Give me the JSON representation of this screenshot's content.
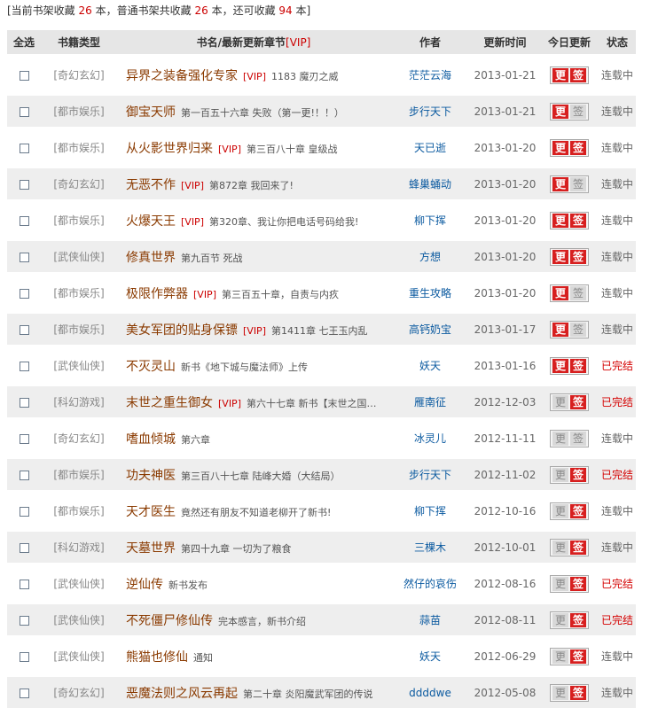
{
  "summary": {
    "prefix": "[当前书架收藏",
    "current": "26",
    "mid1": "本，普通书架共收藏",
    "total": "26",
    "mid2": "本，还可收藏",
    "remaining": "94",
    "suffix": "本]"
  },
  "header": {
    "select_all": "全选",
    "type": "书籍类型",
    "title": "书名/最新更新章节",
    "title_vip": "[VIP]",
    "author": "作者",
    "time": "更新时间",
    "today": "今日更新",
    "status": "状态"
  },
  "buttons": {
    "update": "更",
    "sign": "签"
  },
  "rows": [
    {
      "type": "[奇幻玄幻]",
      "title": "异界之装备强化专家",
      "vip": "[VIP]",
      "chapter": "1183 魔刃之威",
      "author": "茫茫云海",
      "time": "2013-01-21",
      "update_on": true,
      "sign_on": true,
      "status": "连载中",
      "done": false
    },
    {
      "type": "[都市娱乐]",
      "title": "御宝天师",
      "vip": "",
      "chapter": "第一百五十六章 失败（第一更!！！）",
      "author": "步行天下",
      "time": "2013-01-21",
      "update_on": true,
      "sign_on": false,
      "status": "连载中",
      "done": false
    },
    {
      "type": "[都市娱乐]",
      "title": "从火影世界归来",
      "vip": "[VIP]",
      "chapter": "第三百八十章 皇级战",
      "author": "天已逝",
      "time": "2013-01-20",
      "update_on": true,
      "sign_on": true,
      "status": "连载中",
      "done": false
    },
    {
      "type": "[奇幻玄幻]",
      "title": "无恶不作",
      "vip": "[VIP]",
      "chapter": "第872章 我回来了!",
      "author": "蜂巢蛹动",
      "time": "2013-01-20",
      "update_on": true,
      "sign_on": false,
      "status": "连载中",
      "done": false
    },
    {
      "type": "[都市娱乐]",
      "title": "火爆天王",
      "vip": "[VIP]",
      "chapter": "第320章、我让你把电话号码给我!",
      "author": "柳下挥",
      "time": "2013-01-20",
      "update_on": true,
      "sign_on": true,
      "status": "连载中",
      "done": false
    },
    {
      "type": "[武侠仙侠]",
      "title": "修真世界",
      "vip": "",
      "chapter": "第九百节 死战",
      "author": "方想",
      "time": "2013-01-20",
      "update_on": true,
      "sign_on": true,
      "status": "连载中",
      "done": false
    },
    {
      "type": "[都市娱乐]",
      "title": "极限作弊器",
      "vip": "[VIP]",
      "chapter": "第三百五十章，自责与内疚",
      "author": "重生攻略",
      "time": "2013-01-20",
      "update_on": true,
      "sign_on": false,
      "status": "连载中",
      "done": false
    },
    {
      "type": "[都市娱乐]",
      "title": "美女军团的贴身保镖",
      "vip": "[VIP]",
      "chapter": "第1411章 七王玉内乱",
      "author": "高钙奶宝",
      "time": "2013-01-17",
      "update_on": true,
      "sign_on": false,
      "status": "连载中",
      "done": false
    },
    {
      "type": "[武侠仙侠]",
      "title": "不灭灵山",
      "vip": "",
      "chapter": "新书《地下城与魔法师》上传",
      "author": "妖天",
      "time": "2013-01-16",
      "update_on": true,
      "sign_on": true,
      "status": "已完结",
      "done": true
    },
    {
      "type": "[科幻游戏]",
      "title": "末世之重生御女",
      "vip": "[VIP]",
      "chapter": "第六十七章 新书【末世之国…",
      "author": "雁南征",
      "time": "2012-12-03",
      "update_on": false,
      "sign_on": true,
      "status": "已完结",
      "done": true
    },
    {
      "type": "[奇幻玄幻]",
      "title": "嗜血倾城",
      "vip": "",
      "chapter": "第六章",
      "author": "冰灵儿",
      "time": "2012-11-11",
      "update_on": false,
      "sign_on": false,
      "status": "连载中",
      "done": false
    },
    {
      "type": "[都市娱乐]",
      "title": "功夫神医",
      "vip": "",
      "chapter": "第三百八十七章 陆峰大婚（大结局）",
      "author": "步行天下",
      "time": "2012-11-02",
      "update_on": false,
      "sign_on": true,
      "status": "已完结",
      "done": true
    },
    {
      "type": "[都市娱乐]",
      "title": "天才医生",
      "vip": "",
      "chapter": "竟然还有朋友不知道老柳开了新书!",
      "author": "柳下挥",
      "time": "2012-10-16",
      "update_on": false,
      "sign_on": true,
      "status": "连载中",
      "done": false
    },
    {
      "type": "[科幻游戏]",
      "title": "天墓世界",
      "vip": "",
      "chapter": "第四十九章 一切为了粮食",
      "author": "三棵木",
      "time": "2012-10-01",
      "update_on": false,
      "sign_on": true,
      "status": "连载中",
      "done": false
    },
    {
      "type": "[武侠仙侠]",
      "title": "逆仙传",
      "vip": "",
      "chapter": "新书发布",
      "author": "然仔的哀伤",
      "time": "2012-08-16",
      "update_on": false,
      "sign_on": true,
      "status": "已完结",
      "done": true
    },
    {
      "type": "[武侠仙侠]",
      "title": "不死僵尸修仙传",
      "vip": "",
      "chapter": "完本感言，新书介绍",
      "author": "蒜苗",
      "time": "2012-08-11",
      "update_on": false,
      "sign_on": true,
      "status": "已完结",
      "done": true
    },
    {
      "type": "[武侠仙侠]",
      "title": "熊猫也修仙",
      "vip": "",
      "chapter": "通知",
      "author": "妖天",
      "time": "2012-06-29",
      "update_on": false,
      "sign_on": true,
      "status": "连载中",
      "done": false
    },
    {
      "type": "[奇幻玄幻]",
      "title": "恶魔法则之风云再起",
      "vip": "",
      "chapter": "第二十章 炎阳魔武军团的传说",
      "author": "ddddwe",
      "time": "2012-05-08",
      "update_on": false,
      "sign_on": true,
      "status": "连载中",
      "done": false
    }
  ]
}
